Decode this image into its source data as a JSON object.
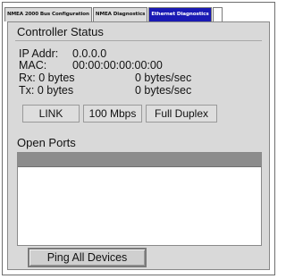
{
  "tabs": [
    {
      "label": "NMEA 2000 Bus Configuration",
      "active": false
    },
    {
      "label": "NMEA Diagnostics",
      "active": false
    },
    {
      "label": "Ethernet Diagnostics",
      "active": true
    }
  ],
  "controller_status": {
    "title": "Controller Status",
    "ip_label": "IP Addr:",
    "ip_value": "0.0.0.0",
    "mac_label": "MAC:",
    "mac_value": "00:00:00:00:00:00",
    "rx_label": "Rx: 0 bytes",
    "rx_rate": "0 bytes/sec",
    "tx_label": "Tx: 0 bytes",
    "tx_rate": "0 bytes/sec",
    "link": "LINK",
    "speed": "100 Mbps",
    "duplex": "Full Duplex"
  },
  "open_ports": {
    "title": "Open Ports"
  },
  "ping_button": "Ping All Devices",
  "colors": {
    "active_tab": "#1a1ab4",
    "panel_bg": "#d9d9d9",
    "list_header": "#8c8c8c"
  }
}
